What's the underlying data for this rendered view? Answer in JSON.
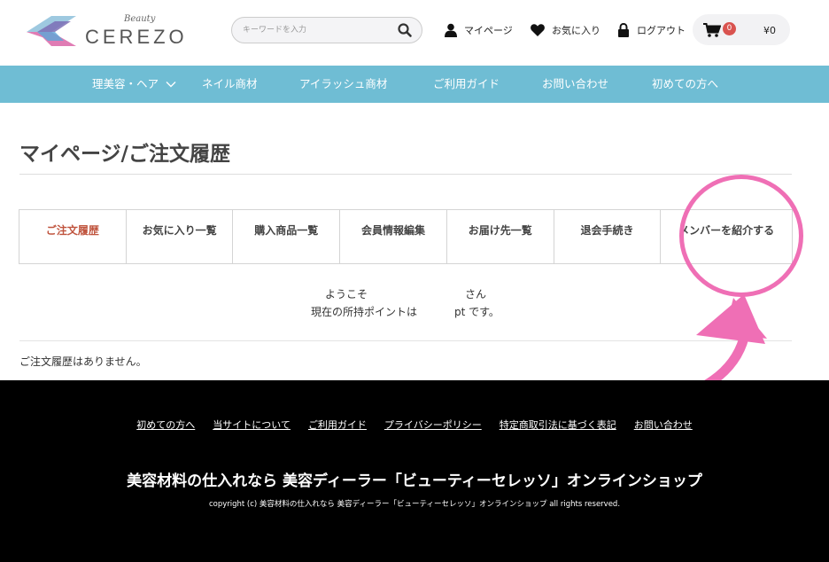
{
  "brand": {
    "script": "Beauty",
    "name": "CEREZO"
  },
  "search": {
    "placeholder": "キーワードを入力"
  },
  "header_nav": {
    "mypage": "マイページ",
    "favorites": "お気に入り",
    "logout": "ログアウト"
  },
  "cart": {
    "count": "0",
    "total": "¥0"
  },
  "category_nav": [
    {
      "label": "理美容・ヘア"
    },
    {
      "label": "ネイル商材"
    },
    {
      "label": "アイラッシュ商材"
    },
    {
      "label": "ご利用ガイド"
    },
    {
      "label": "お問い合わせ"
    },
    {
      "label": "初めての方へ"
    }
  ],
  "page_title": "マイページ/ご注文履歴",
  "tabs": [
    {
      "label": "ご注文履歴",
      "active": true
    },
    {
      "label": "お気に入り一覧"
    },
    {
      "label": "購入商品一覧"
    },
    {
      "label": "会員情報編集"
    },
    {
      "label": "お届け先一覧"
    },
    {
      "label": "退会手続き"
    },
    {
      "label": "メンバーを紹介する"
    }
  ],
  "welcome": {
    "prefix": "ようこそ",
    "suffix": "さん",
    "points_prefix": "現在の所持ポイントは",
    "points_suffix": "pt です。"
  },
  "orders": {
    "empty_message": "ご注文履歴はありません。"
  },
  "footer": {
    "links": [
      "初めての方へ",
      "当サイトについて",
      "ご利用ガイド",
      "プライバシーポリシー",
      "特定商取引法に基づく表記",
      "お問い合わせ"
    ],
    "tagline": "美容材料の仕入れなら 美容ディーラー「ビューティーセレッソ」オンラインショップ",
    "copyright": "copyright (c) 美容材料の仕入れなら 美容ディーラー「ビューティーセレッソ」オンラインショップ all rights reserved."
  },
  "colors": {
    "category_bar": "#6fbdd4",
    "active_tab": "#c0553f",
    "annotation": "#ef6fb5",
    "footer_bg": "#000000"
  },
  "icons": [
    "search-icon",
    "user-icon",
    "heart-icon",
    "lock-icon",
    "cart-icon",
    "chevron-down-icon"
  ]
}
